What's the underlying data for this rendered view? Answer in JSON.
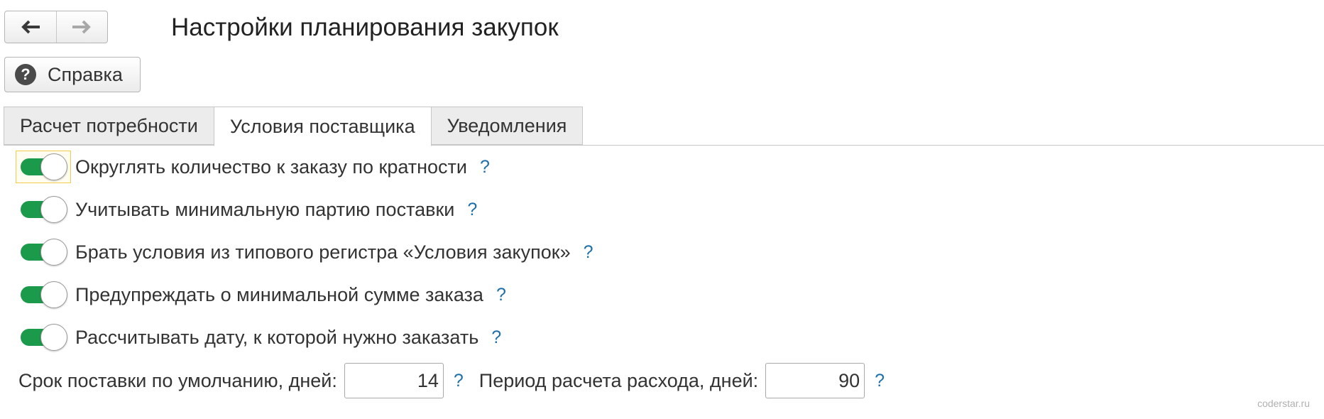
{
  "header": {
    "title": "Настройки планирования закупок",
    "help_label": "Справка",
    "help_icon_glyph": "?"
  },
  "tabs": [
    {
      "label": "Расчет потребности",
      "active": false
    },
    {
      "label": "Условия поставщика",
      "active": true
    },
    {
      "label": "Уведомления",
      "active": false
    }
  ],
  "options": [
    {
      "label": "Округлять количество к заказу по кратности",
      "enabled": true,
      "help": "?"
    },
    {
      "label": "Учитывать минимальную партию поставки",
      "enabled": true,
      "help": "?"
    },
    {
      "label": "Брать условия из типового регистра «Условия закупок»",
      "enabled": true,
      "help": "?"
    },
    {
      "label": "Предупреждать о минимальной сумме заказа",
      "enabled": true,
      "help": "?"
    },
    {
      "label": "Рассчитывать дату, к которой нужно заказать",
      "enabled": true,
      "help": "?"
    }
  ],
  "fields": {
    "delivery_term": {
      "label": "Срок поставки по умолчанию, дней:",
      "value": "14",
      "help": "?"
    },
    "consumption_period": {
      "label": "Период расчета расхода, дней:",
      "value": "90",
      "help": "?"
    }
  },
  "watermark": "coderstar.ru",
  "colors": {
    "toggle_on": "#1a9a4a",
    "help_link": "#1f6fa8",
    "focus_border": "#f2cc4a"
  }
}
